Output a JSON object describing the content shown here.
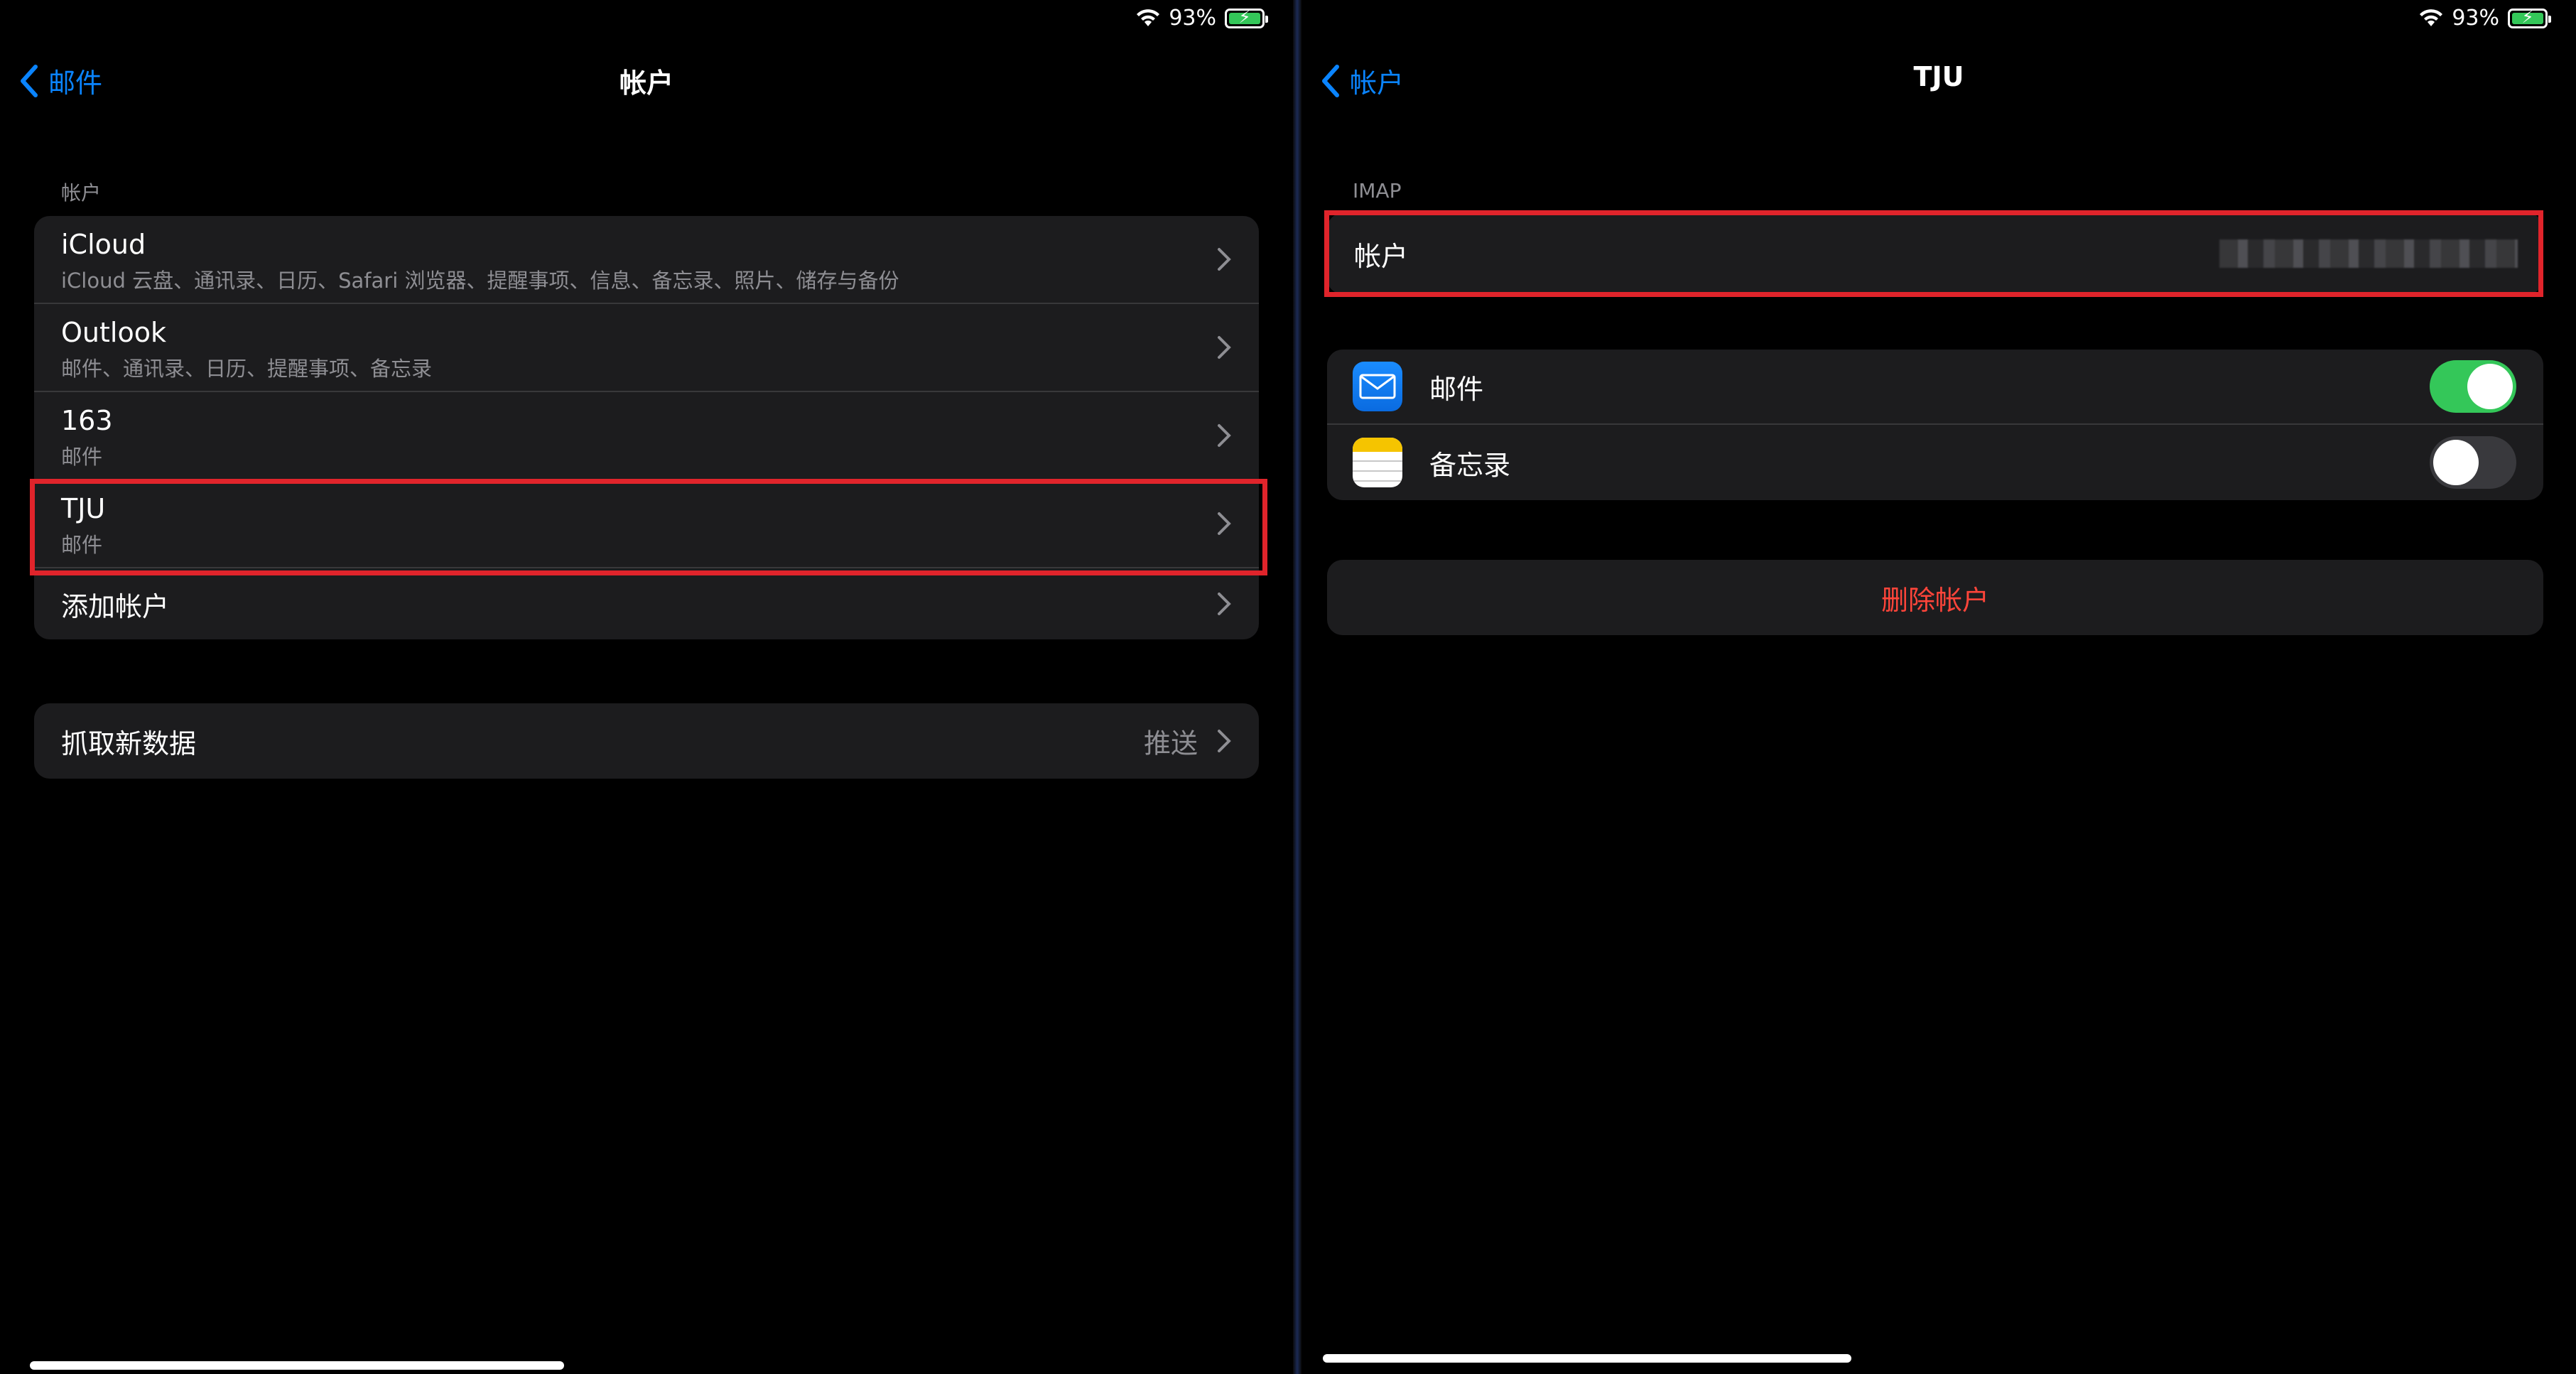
{
  "left": {
    "status": {
      "battery": "93%"
    },
    "nav": {
      "back_label": "邮件",
      "title": "帐户"
    },
    "accounts_header": "帐户",
    "accounts": [
      {
        "name": "iCloud",
        "detail": "iCloud 云盘、通讯录、日历、Safari 浏览器、提醒事项、信息、备忘录、照片、储存与备份"
      },
      {
        "name": "Outlook",
        "detail": "邮件、通讯录、日历、提醒事项、备忘录"
      },
      {
        "name": "163",
        "detail": "邮件"
      },
      {
        "name": "TJU",
        "detail": "邮件"
      }
    ],
    "add_account": "添加帐户",
    "fetch": {
      "label": "抓取新数据",
      "value": "推送"
    }
  },
  "right": {
    "status": {
      "battery": "93%"
    },
    "nav": {
      "back_label": "帐户",
      "title": "TJU"
    },
    "imap_header": "IMAP",
    "account_row_label": "帐户",
    "services": [
      {
        "label": "邮件",
        "icon": "mail-icon",
        "enabled": true
      },
      {
        "label": "备忘录",
        "icon": "notes-icon",
        "enabled": false
      }
    ],
    "delete_label": "删除帐户"
  },
  "colors": {
    "accent": "#0a84ff",
    "destructive": "#ff453a",
    "toggle_on": "#34c759",
    "highlight": "#e0242b"
  }
}
